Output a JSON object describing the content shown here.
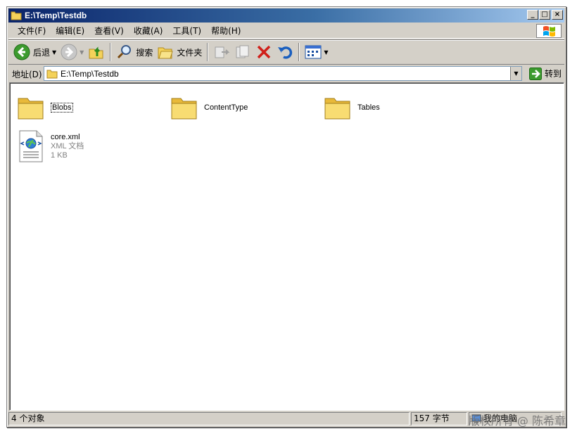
{
  "window": {
    "title": "E:\\Temp\\Testdb",
    "buttons": {
      "minimize": "_",
      "maximize": "□",
      "close": "×"
    }
  },
  "menubar": {
    "items": [
      "文件(F)",
      "编辑(E)",
      "查看(V)",
      "收藏(A)",
      "工具(T)",
      "帮助(H)"
    ]
  },
  "toolbar": {
    "back_label": "后退",
    "search_label": "搜索",
    "folders_label": "文件夹"
  },
  "address": {
    "label": "地址(D)",
    "value": "E:\\Temp\\Testdb",
    "go_label": "转到"
  },
  "content": {
    "folders": [
      "Blobs",
      "ContentType",
      "Tables"
    ],
    "file": {
      "name": "core.xml",
      "type": "XML 文档",
      "size": "1 KB"
    }
  },
  "statusbar": {
    "objects": "4 个对象",
    "size": "157 字节",
    "location": "我的电脑"
  },
  "watermark": "版权所有 @ 陈希章",
  "colors": {
    "titlebar_start": "#0a246a",
    "titlebar_end": "#a6caf0",
    "folder": "#f4d25a",
    "chrome": "#d4d0c8"
  }
}
